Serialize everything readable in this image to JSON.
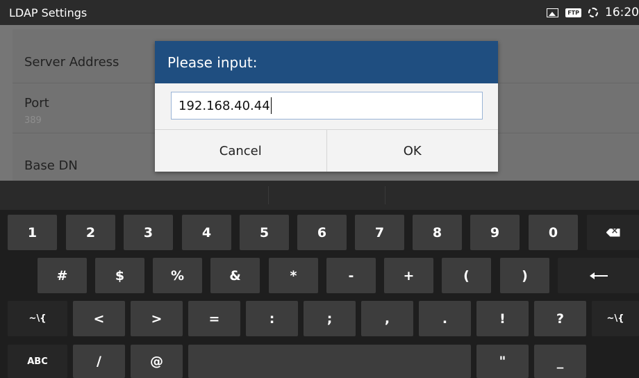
{
  "statusbar": {
    "title": "LDAP Settings",
    "icons": [
      "image-icon",
      "ftp-icon",
      "sync-icon"
    ],
    "ftp_label": "FTP",
    "time": "16:20"
  },
  "settings": {
    "server_address_label": "Server Address",
    "port_label": "Port",
    "port_value": "389",
    "base_dn_label": "Base DN"
  },
  "dialog": {
    "title": "Please input:",
    "input_value": "192.168.40.44",
    "cancel_label": "Cancel",
    "ok_label": "OK",
    "header_color": "#1f4e80"
  },
  "keyboard": {
    "row1": [
      "1",
      "2",
      "3",
      "4",
      "5",
      "6",
      "7",
      "8",
      "9",
      "0"
    ],
    "row2": [
      "#",
      "$",
      "%",
      "&",
      "*",
      "-",
      "+",
      "(",
      ")"
    ],
    "row3_left": "~\\{",
    "row3": [
      "<",
      ">",
      "=",
      ":",
      ";",
      ",",
      ".",
      "!",
      "?"
    ],
    "row3_right": "~\\{",
    "row4": {
      "abc": "ABC",
      "slash": "/",
      "at": "@",
      "quote": "\"",
      "underscore": "_"
    }
  }
}
